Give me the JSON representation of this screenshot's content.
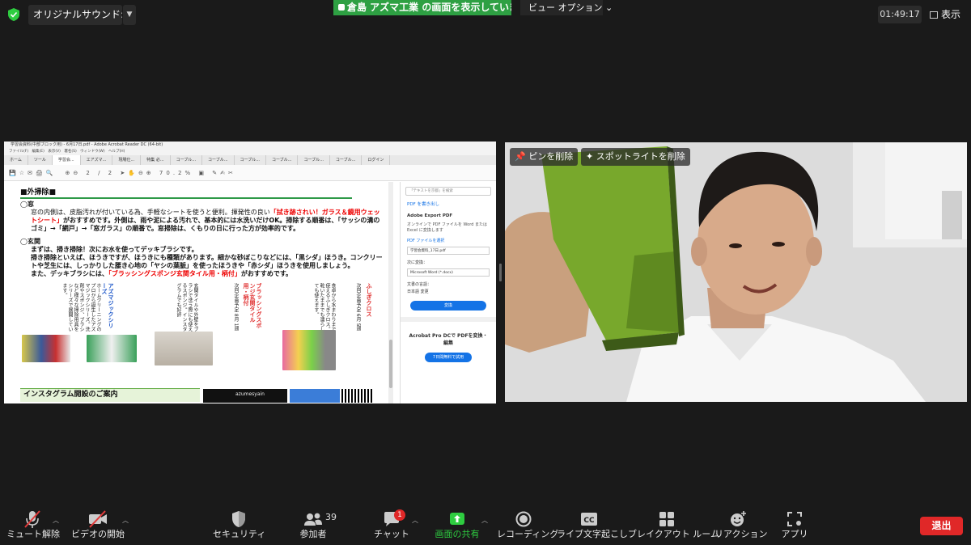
{
  "topbar": {
    "original_sound": "オリジナルサウンド: オン",
    "share_banner": "倉島 アズマ工業 の画面を表示しています",
    "view_options": "ビュー オプション ⌄",
    "clock": "01:49:17",
    "view_button": "表示"
  },
  "pdf": {
    "title": "学習会資料(中部ブロック用) - 6月17日.pdf - Adobe Acrobat Reader DC (64-bit)",
    "menu": "ファイル(F) 編集(E) 表示(V) 署名(S) ウィンドウ(W) ヘルプ(H)",
    "tabs": [
      "ホーム",
      "ツール",
      "学習会...",
      "エアズマ...",
      "現場仕...",
      "特集 必...",
      "コーブル...",
      "コーブル...",
      "コーブル...",
      "コーブル...",
      "コーブル...",
      "コーブル...",
      "ログイン"
    ],
    "page_indicator": "2 / 2",
    "zoom": "70.2%",
    "section_head": "■外掃除■",
    "window_head": "◯窓",
    "window_p1a": "窓の内側は、皮脂汚れが付いている為、手軽なシートを使うと便利。揮発性の良い",
    "window_p1_red": "「拭き跡されい！ガラス＆鏡用ウェットシート」",
    "window_p1b": "がおすすめです。外側は、雨や泥による汚れで、基本的には水洗いだけOK。掃除する順番は、「サッシの溝のゴミ」→「網戸」→「窓ガラス」の順番で。窓掃除は、くもりの日に行った方が効率的です。",
    "entrance_head": "◯玄関",
    "entrance_p1": "まずは、掃き掃除！次にお水を使ってデッキブラシです。",
    "entrance_p2": "掃き掃除といえば、ほうきですが、ほうきにも種類があります。細かな砂ぼこりなどには、「黒シダ」ほうき。コンクリートや芝生には、しっかりした腰き心地の「ヤシの葉脈」を使ったほうきや「赤シダ」ほうきを使用しましょう。",
    "entrance_p3a": "また、デッキブラシには、",
    "entrance_p3_red": "「ブラッシングスポンジ玄関タイル用・柄付」",
    "entrance_p3b": "がおすすめです。",
    "mag_col1_head": "アズマジックシリーズ",
    "mag_col1": "ホームクリーニングのプロから誕生したアズマジックシリーズ。洗剤やスポンジ、ブラシなど様々な掃除用具をシリーズで展開しています。",
    "mag_col2": "玄関タイルや外壁をブラシで洗う際にも使えるスポンジ。インスタグラムでも好評",
    "mag_col3_head": "ブラッシングスポンジ玄関タイル用・柄付",
    "mag_col3_sub": "次回企画予定 8月 1週",
    "mag_col4": "食卓から水まわりまで使えるふしぎクロス。乾いたままでも濡らしても使えます。",
    "mag_col5_head": "ふしぎクロス",
    "mag_col5_sub": "次回企画予定 6月 5週",
    "insta_title": "インスタグラム開設のご案内",
    "insta_account": "azumesyain",
    "sidebar": {
      "search_placeholder": "「テキストを京都」を検索",
      "create_pdf": "PDF を書き出し",
      "export_title": "Adobe Export PDF",
      "export_desc": "オンラインで PDF ファイルを Word または Excel に変換します",
      "select_file": "PDF ファイルを選択",
      "file_name": "学習会資料_17日.pdf",
      "convert_to_label": "次に変換：",
      "convert_to_value": "Microsoft Word (*.docx)",
      "doc_lang_label": "文書の言語：",
      "doc_lang_value": "日本語 変更",
      "convert_button": "変換",
      "pro_title": "Acrobat Pro DCで PDFを変換・編集",
      "trial_button": "7日間無料で試用"
    }
  },
  "video": {
    "unpin": "ピンを削除",
    "remove_spotlight": "スポットライトを削除"
  },
  "toolbar": {
    "mute": "ミュート解除",
    "video": "ビデオの開始",
    "security": "セキュリティ",
    "participants": "参加者",
    "participants_count": "39",
    "chat": "チャット",
    "chat_badge": "1",
    "share": "画面の共有",
    "record": "レコーディング",
    "captions": "ライブ文字起こし",
    "breakout": "ブレイクアウト ルーム",
    "reactions": "リアクション",
    "apps": "アプリ",
    "leave": "退出",
    "cc_text": "CC"
  },
  "colors": {
    "share_green": "#2ea043",
    "leave_red": "#e02828",
    "mute_red": "#e03b3b"
  }
}
